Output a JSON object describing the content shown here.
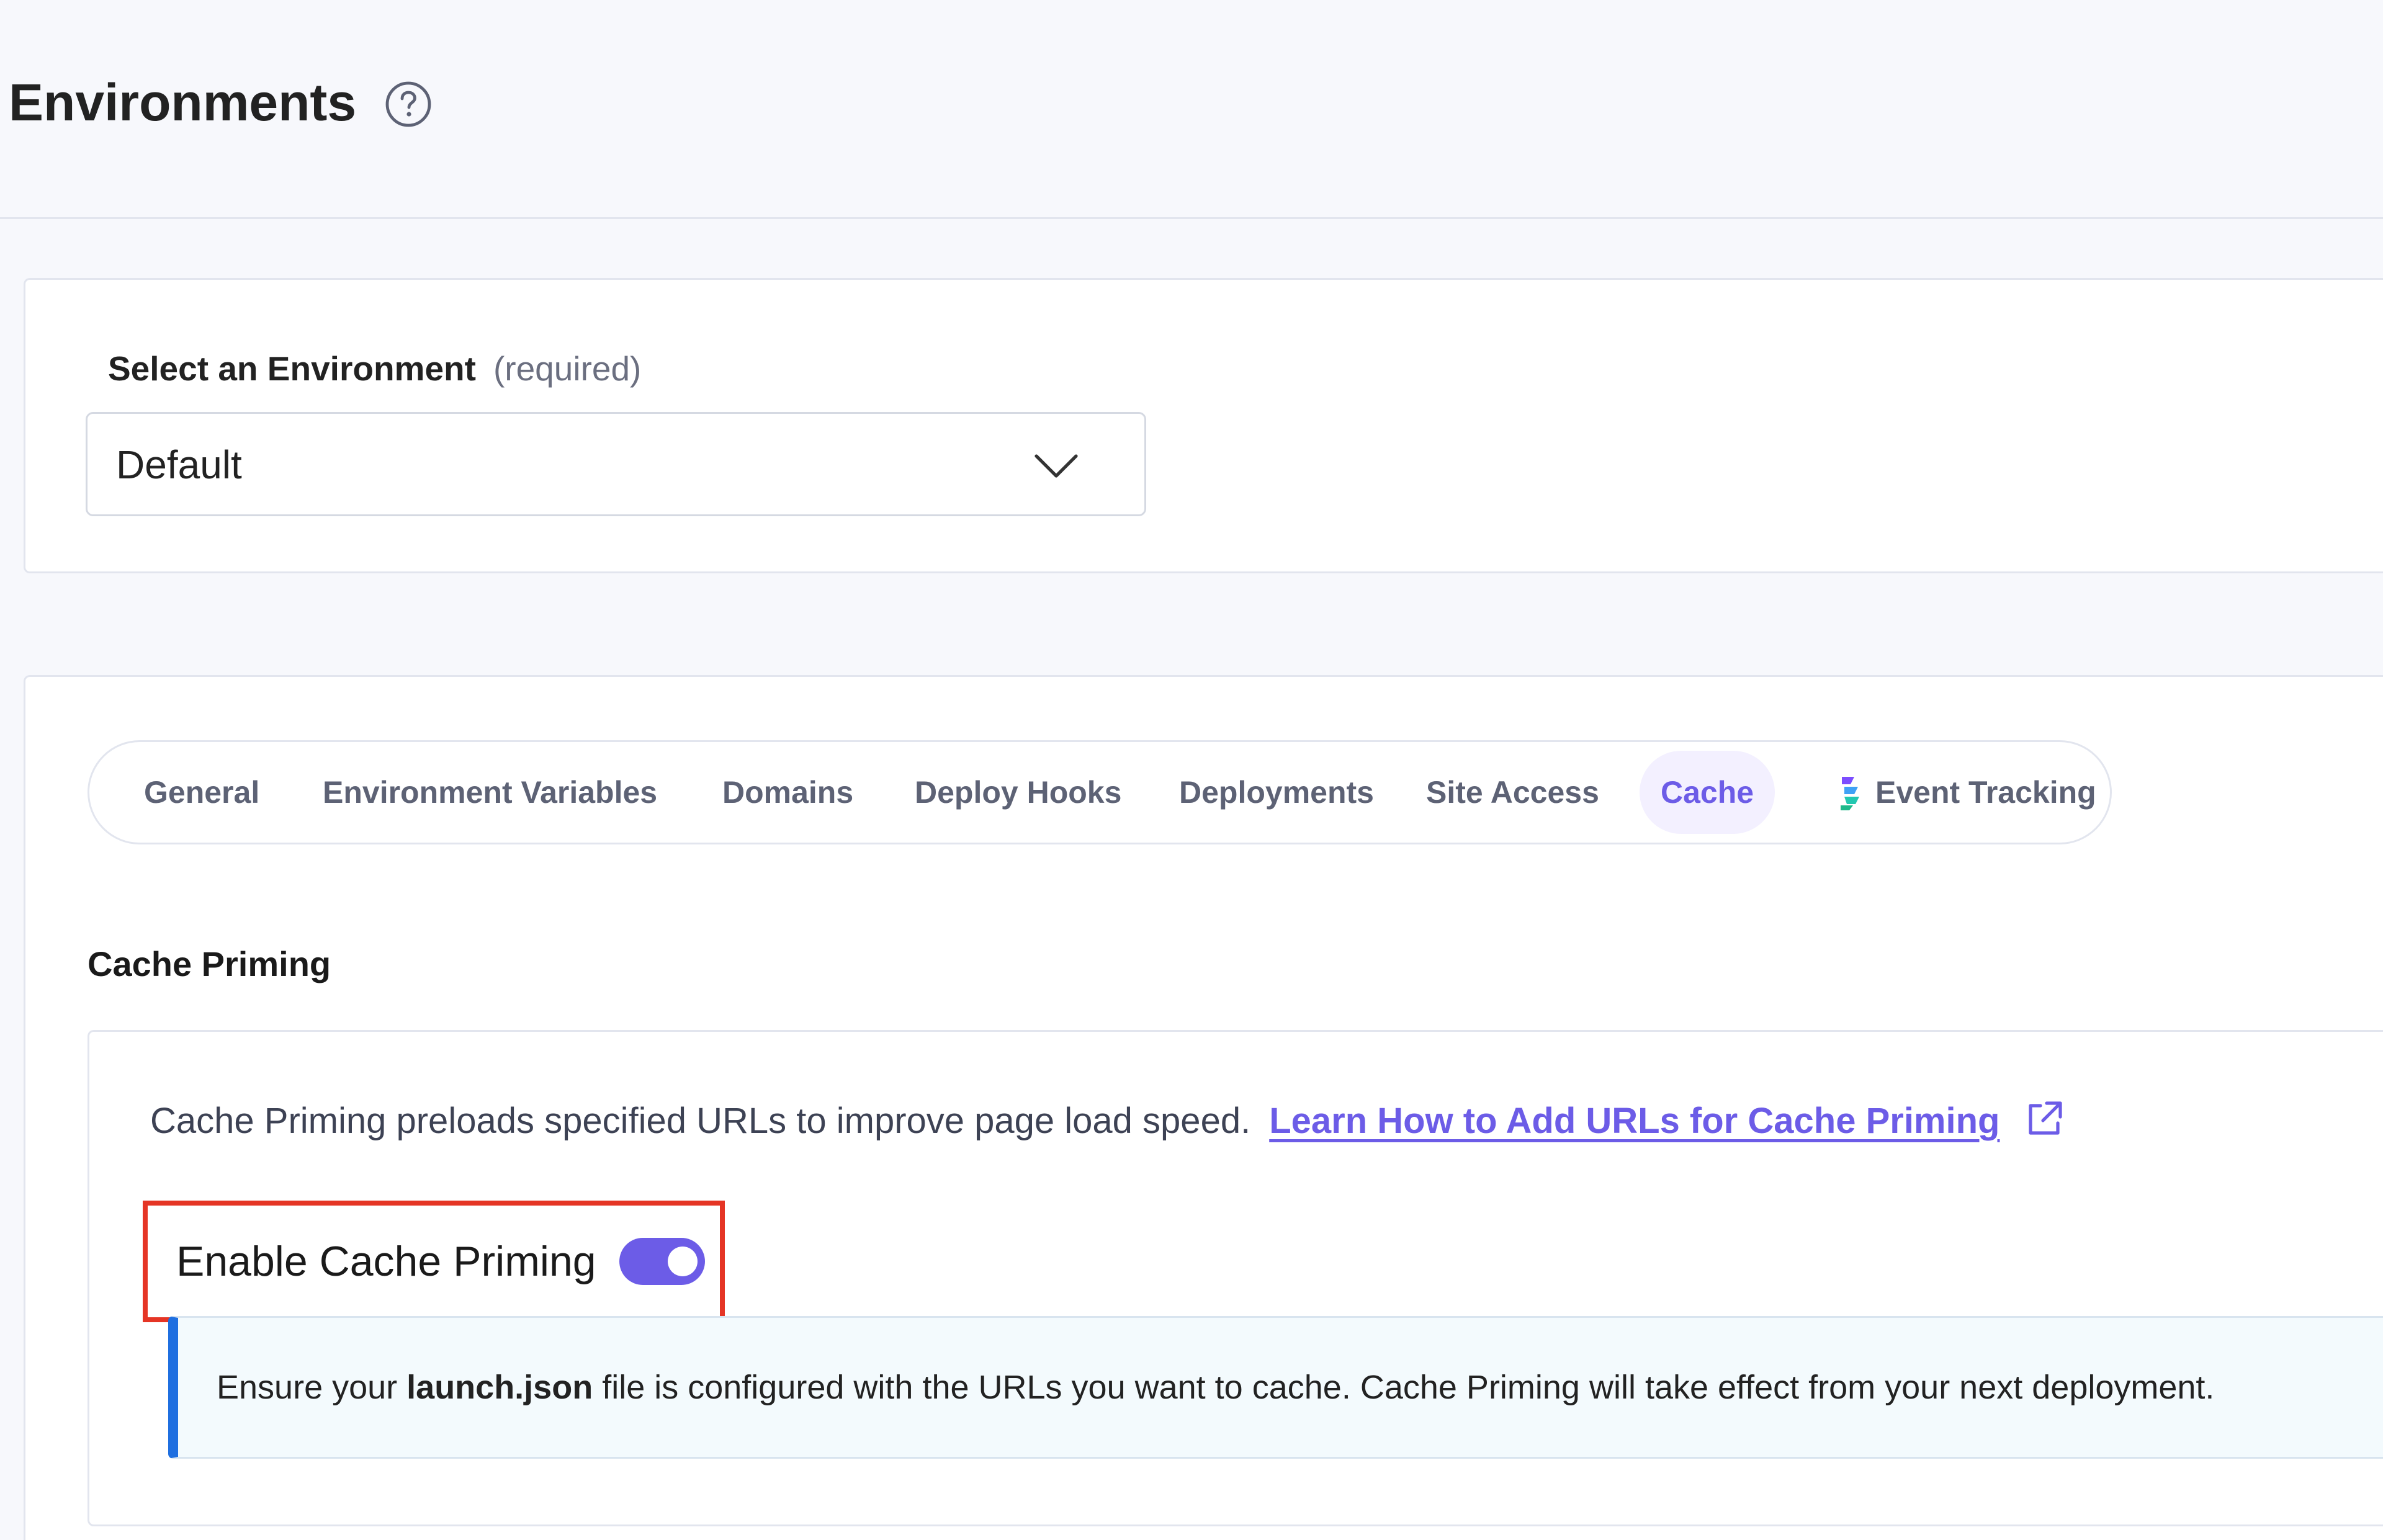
{
  "header": {
    "title": "Environments"
  },
  "environment_select": {
    "label": "Select an Environment",
    "required_text": "(required)",
    "value": "Default"
  },
  "tabs": [
    {
      "label": "General",
      "active": false
    },
    {
      "label": "Environment Variables",
      "active": false
    },
    {
      "label": "Domains",
      "active": false
    },
    {
      "label": "Deploy Hooks",
      "active": false
    },
    {
      "label": "Deployments",
      "active": false
    },
    {
      "label": "Site Access",
      "active": false
    },
    {
      "label": "Cache",
      "active": true
    },
    {
      "label": "Event Tracking",
      "active": false,
      "icon": "event-tracking-logo-icon"
    }
  ],
  "cache_priming": {
    "section_title": "Cache Priming",
    "description": "Cache Priming preloads specified URLs to improve page load speed.",
    "learn_link": "Learn How to Add URLs for Cache Priming",
    "toggle_label": "Enable Cache Priming",
    "toggle_enabled": true,
    "info": {
      "prefix": "Ensure your ",
      "filename": "launch.json",
      "suffix": " file is configured with the URLs you want to cache. Cache Priming will take effect from your next deployment."
    }
  },
  "colors": {
    "accent": "#6c5ce7",
    "highlight": "#e53525",
    "info_border": "#1f6fe0",
    "background": "#f7f8fc"
  }
}
